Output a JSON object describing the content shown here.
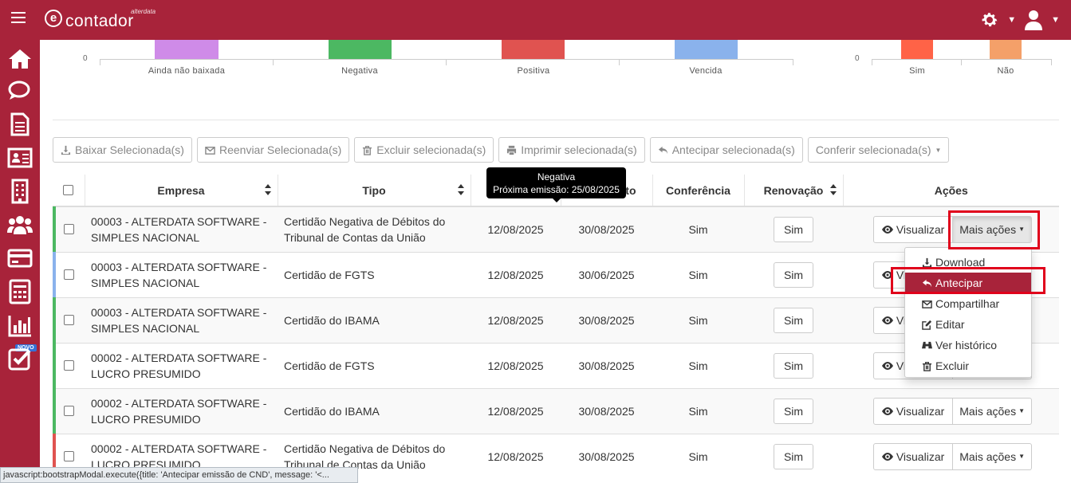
{
  "app": {
    "logo_letter": "e",
    "logo_text": "contador",
    "logo_sup": "alterdata"
  },
  "sidebar": {
    "items": [
      "home-icon",
      "chat-icon",
      "document-icon",
      "id-card-icon",
      "building-icon",
      "users-icon",
      "credit-card-icon",
      "calculator-icon",
      "bar-chart-icon",
      "checklist-icon"
    ],
    "badge": "NOVO"
  },
  "charts": {
    "left": {
      "zero": "0",
      "categories": [
        "Ainda não baixada",
        "Negativa",
        "Positiva",
        "Vencida"
      ],
      "colors": [
        "#cf8be8",
        "#4cb862",
        "#e05350",
        "#8ab2ec"
      ]
    },
    "right": {
      "zero": "0",
      "categories": [
        "Sim",
        "Não"
      ],
      "colors": [
        "#ff6347",
        "#f4a069"
      ]
    }
  },
  "toolbar": {
    "baixar": "Baixar Selecionada(s)",
    "reenviar": "Reenviar Selecionada(s)",
    "excluir": "Excluir selecionada(s)",
    "imprimir": "Imprimir selecionada(s)",
    "antecipar": "Antecipar selecionada(s)",
    "conferir": "Conferir selecionada(s)"
  },
  "table": {
    "headers": {
      "empresa": "Empresa",
      "tipo": "Tipo",
      "vencimento": "to",
      "conferencia": "Conferência",
      "renovacao": "Renovação",
      "acoes": "Ações"
    },
    "rows": [
      {
        "empresa_l1": "00003 - ALTERDATA SOFTWARE -",
        "empresa_l2": "SIMPLES NACIONAL",
        "tipo_l1": "Certidão Negativa de Débitos do",
        "tipo_l2": "Tribunal de Contas da União",
        "emissao": "12/08/2025",
        "vencimento": "30/08/2025",
        "conferencia": "Sim",
        "renovacao": "Sim",
        "color": "#4cb862"
      },
      {
        "empresa_l1": "00003 - ALTERDATA SOFTWARE -",
        "empresa_l2": "SIMPLES NACIONAL",
        "tipo_l1": "Certidão de FGTS",
        "tipo_l2": "",
        "emissao": "12/08/2025",
        "vencimento": "30/06/2025",
        "conferencia": "Sim",
        "renovacao": "Sim",
        "color": "#8ab2ec"
      },
      {
        "empresa_l1": "00003 - ALTERDATA SOFTWARE -",
        "empresa_l2": "SIMPLES NACIONAL",
        "tipo_l1": "Certidão do IBAMA",
        "tipo_l2": "",
        "emissao": "12/08/2025",
        "vencimento": "30/08/2025",
        "conferencia": "Sim",
        "renovacao": "Sim",
        "color": "#4cb862"
      },
      {
        "empresa_l1": "00002 - ALTERDATA SOFTWARE -",
        "empresa_l2": "LUCRO PRESUMIDO",
        "tipo_l1": "Certidão de FGTS",
        "tipo_l2": "",
        "emissao": "12/08/2025",
        "vencimento": "30/08/2025",
        "conferencia": "Sim",
        "renovacao": "Sim",
        "color": "#4cb862"
      },
      {
        "empresa_l1": "00002 - ALTERDATA SOFTWARE -",
        "empresa_l2": "LUCRO PRESUMIDO",
        "tipo_l1": "Certidão do IBAMA",
        "tipo_l2": "",
        "emissao": "12/08/2025",
        "vencimento": "30/08/2025",
        "conferencia": "Sim",
        "renovacao": "Sim",
        "color": "#4cb862"
      },
      {
        "empresa_l1": "00002 - ALTERDATA SOFTWARE -",
        "empresa_l2": "LUCRO PRESUMIDO",
        "tipo_l1": "Certidão Negativa de Débitos do",
        "tipo_l2": "Tribunal de Contas da União",
        "emissao": "12/08/2025",
        "vencimento": "30/08/2025",
        "conferencia": "Sim",
        "renovacao": "Sim",
        "color": "#e05350"
      }
    ],
    "visualizar": "Visualizar",
    "mais_acoes": "Mais ações"
  },
  "tooltip": {
    "title": "Negativa",
    "text": "Próxima emissão: 25/08/2025"
  },
  "dropdown": {
    "items": [
      {
        "label": "Download",
        "icon": "download-icon"
      },
      {
        "label": "Antecipar",
        "icon": "reply-icon"
      },
      {
        "label": "Compartilhar",
        "icon": "envelope-icon"
      },
      {
        "label": "Editar",
        "icon": "edit-icon"
      },
      {
        "label": "Ver histórico",
        "icon": "binoculars-icon"
      },
      {
        "label": "Excluir",
        "icon": "trash-icon"
      }
    ]
  },
  "status_bar": "javascript:bootstrapModal.execute({title: 'Antecipar emissão de CND', message: '<..."
}
